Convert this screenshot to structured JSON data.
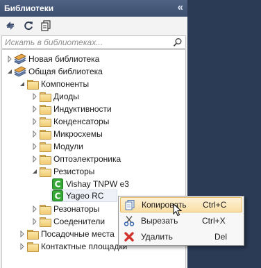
{
  "panel": {
    "title": "Библиотеки",
    "collapse_glyph": "«"
  },
  "toolbar": {
    "icons": [
      "swap-arrows-icon",
      "refresh-icon",
      "copy-pages-icon"
    ]
  },
  "search": {
    "placeholder": "Искать в библиотеках...",
    "value": ""
  },
  "tree": {
    "libraries": [
      {
        "label": "Новая библиотека",
        "expanded": false
      },
      {
        "label": "Общая библиотека",
        "expanded": true
      }
    ],
    "components": "Компоненты",
    "categories": [
      "Диоды",
      "Индуктивности",
      "Конденсаторы",
      "Микросхемы",
      "Модули",
      "Оптоэлектроника",
      "Резисторы"
    ],
    "resistor_items": [
      "Vishay TNPW e3",
      "Yageo RC"
    ],
    "after_categories": [
      "Резонаторы",
      "Соеденители"
    ],
    "top_folders": [
      "Посадочные места",
      "Контактные площадки"
    ]
  },
  "context_menu": {
    "items": [
      {
        "label": "Копировать",
        "shortcut": "Ctrl+C",
        "icon": "copy-icon",
        "highlighted": true
      },
      {
        "label": "Вырезать",
        "shortcut": "Ctrl+X",
        "icon": "scissors-icon",
        "highlighted": false
      },
      {
        "label": "Удалить",
        "shortcut": "Del",
        "icon": "delete-x-icon",
        "highlighted": false
      }
    ]
  },
  "colors": {
    "title_bar": "#445677",
    "background": "#2b3a55",
    "component_icon": "#2fa12f",
    "delete_red": "#d2322d",
    "highlight": "#f9dfa6"
  }
}
